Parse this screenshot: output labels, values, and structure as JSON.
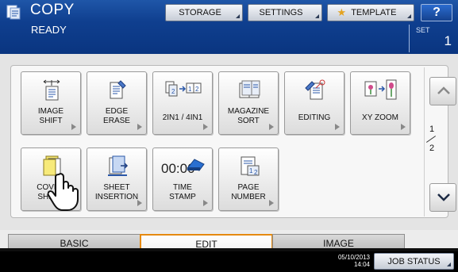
{
  "header": {
    "app_title": "COPY",
    "status": "READY",
    "buttons": {
      "storage": "STORAGE",
      "settings": "SETTINGS",
      "template": "TEMPLATE",
      "help": "?"
    },
    "set_label": "SET",
    "set_count": "1"
  },
  "functions": [
    {
      "label": "IMAGE\nSHIFT",
      "icon": "image-shift-icon"
    },
    {
      "label": "EDGE\nERASE",
      "icon": "edge-erase-icon"
    },
    {
      "label": "2IN1 / 4IN1",
      "icon": "2in1-4in1-icon"
    },
    {
      "label": "MAGAZINE\nSORT",
      "icon": "magazine-sort-icon"
    },
    {
      "label": "EDITING",
      "icon": "editing-icon"
    },
    {
      "label": "XY ZOOM",
      "icon": "xy-zoom-icon"
    },
    {
      "label": "COVER\nSHEET",
      "icon": "cover-sheet-icon"
    },
    {
      "label": "SHEET\nINSERTION",
      "icon": "sheet-insertion-icon"
    },
    {
      "label": "TIME\nSTAMP",
      "icon": "time-stamp-icon"
    },
    {
      "label": "PAGE\nNUMBER",
      "icon": "page-number-icon"
    }
  ],
  "time_stamp_icon_text": "00:00",
  "pagination": {
    "current": "1",
    "total": "2"
  },
  "tabs": [
    {
      "label": "BASIC",
      "active": false
    },
    {
      "label": "EDIT",
      "active": true
    },
    {
      "label": "IMAGE",
      "active": false
    }
  ],
  "footer": {
    "date": "05/10/2013",
    "time": "14:04",
    "job_status": "JOB STATUS"
  },
  "colors": {
    "header_blue": "#0f3f8f",
    "active_tab_border": "#e58a10",
    "help_button": "#1f57b8"
  }
}
